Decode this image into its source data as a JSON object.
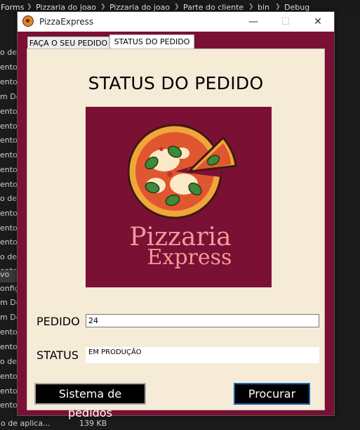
{
  "background": {
    "breadcrumb": [
      "Forms",
      "Pizzaria do joao",
      "Pizzaria do joao",
      "Parte do cliente",
      "bin",
      "Debug"
    ],
    "left_items": [
      "o de",
      "ento",
      "ento",
      "m De",
      "ento",
      "ento",
      "ento",
      "ento",
      "ento",
      "ento",
      "o de",
      "ento",
      "ento",
      "ento",
      "o de",
      "ento",
      "vo",
      "onfig",
      "m De",
      "m De",
      "ento",
      "ento",
      "o de",
      "ento",
      "ento",
      "ento"
    ],
    "bottom_name": "o de aplica...",
    "bottom_size": "139 KB"
  },
  "window": {
    "title": "PizzaExpress",
    "minimize": "—",
    "maximize": "☐",
    "close": "✕"
  },
  "tabs": [
    {
      "label": "FAÇA O SEU PEDIDO"
    },
    {
      "label": "STATUS DO PEDIDO"
    }
  ],
  "panel": {
    "heading": "STATUS DO PEDIDO",
    "logo_line1": "Pizzaria",
    "logo_line2": "Express",
    "pedido_label": "PEDIDO",
    "pedido_value": "24",
    "status_label": "STATUS",
    "status_value": "EM PRODUÇÃO",
    "btn_sistema": "Sistema de pedidos",
    "btn_procurar": "Procurar"
  },
  "colors": {
    "window_bg": "#7a1034",
    "panel_bg": "#f6ebd7",
    "logo_bg": "#7a1034",
    "logo_text": "#f29a9a"
  }
}
